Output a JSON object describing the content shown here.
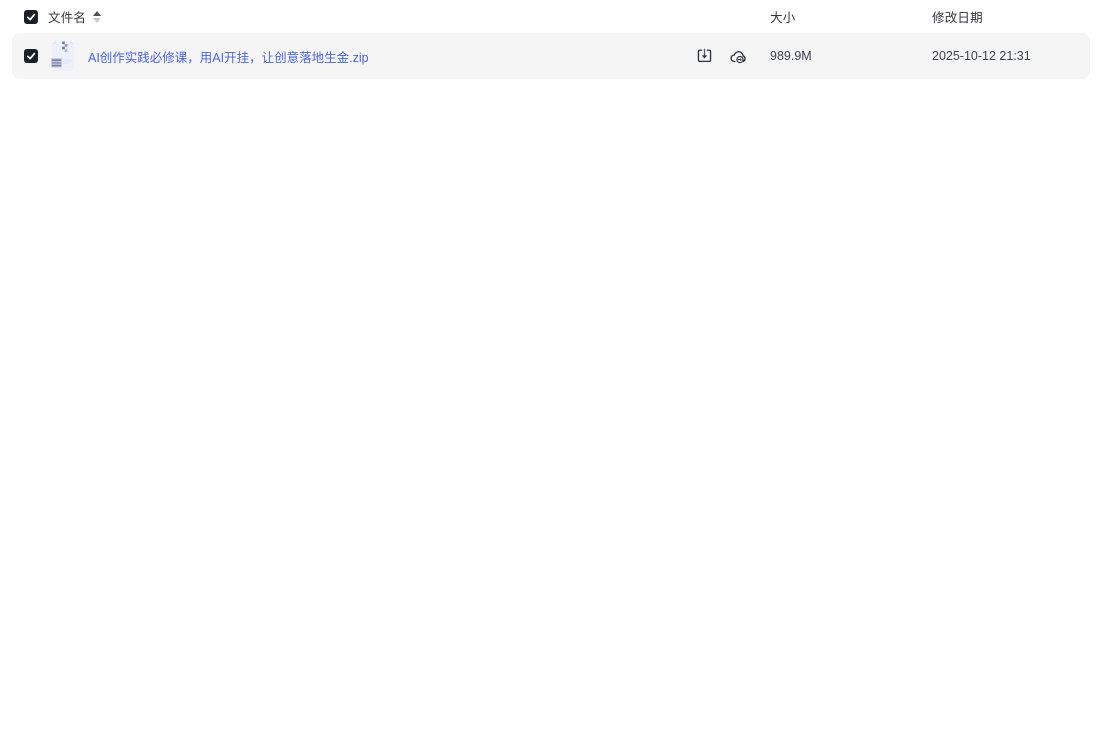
{
  "header": {
    "select_all_checked": true,
    "columns": {
      "name": "文件名",
      "size": "大小",
      "modified": "修改日期"
    },
    "sort": {
      "column": "name",
      "direction": "asc"
    }
  },
  "files": [
    {
      "name": "AI创作实践必修课，用AI开挂，让创意落地生金.zip",
      "type": "zip",
      "size": "989.9M",
      "modified": "2025-10-12 21:31",
      "checked": true,
      "actions": [
        "download",
        "save-to-cloud"
      ]
    }
  ],
  "icons": {
    "checkbox_check": "check-mark",
    "sort": "sort-asc-triangles",
    "file": "zip-archive-icon",
    "download": "download-tray-icon",
    "cloud": "cloud-transfer-icon"
  },
  "colors": {
    "page_background": "#ffffff",
    "row_background": "#f5f5f6",
    "checkbox": "#1b1f26",
    "link": "#4a63e2",
    "text_primary": "#30353d",
    "text_value": "#3c424b",
    "icon_stroke": "#2b2f36",
    "zip_body": "#edeffa",
    "zip_accent": "#76819f"
  }
}
